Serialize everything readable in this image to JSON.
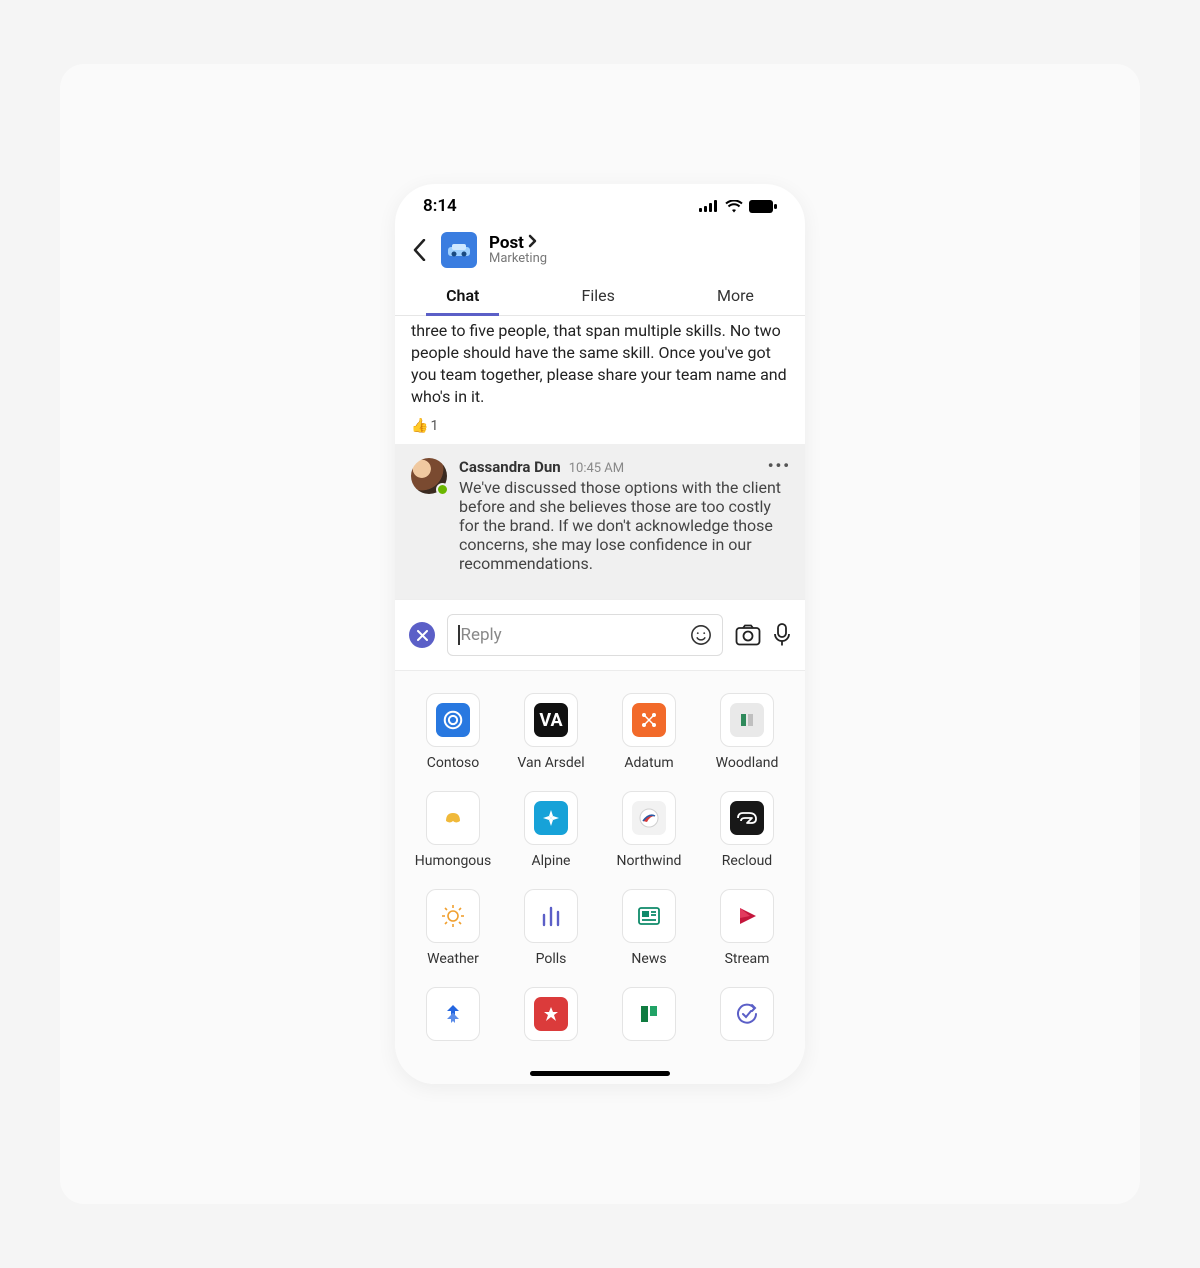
{
  "status": {
    "time": "8:14"
  },
  "header": {
    "title": "Post",
    "subtitle": "Marketing"
  },
  "tabs": {
    "chat": "Chat",
    "files": "Files",
    "more": "More"
  },
  "message1": {
    "text": "three to five people, that span multiple skills. No two people should have the same skill. Once you've got you team together, please share your team name and who's in it.",
    "reaction_count": "1"
  },
  "reply": {
    "author": "Cassandra Dun",
    "time": "10:45 AM",
    "text": "We've discussed those options with the client before and she believes those are too costly for the brand. If we don't acknowledge those concerns, she may lose confidence in our recommendations."
  },
  "compose": {
    "placeholder": "Reply"
  },
  "apps": {
    "r1c1": "Contoso",
    "r1c2": "Van Arsdel",
    "r1c3": "Adatum",
    "r1c4": "Woodland",
    "r2c1": "Humongous",
    "r2c2": "Alpine",
    "r2c3": "Northwind",
    "r2c4": "Recloud",
    "r3c1": "Weather",
    "r3c2": "Polls",
    "r3c3": "News",
    "r3c4": "Stream"
  }
}
